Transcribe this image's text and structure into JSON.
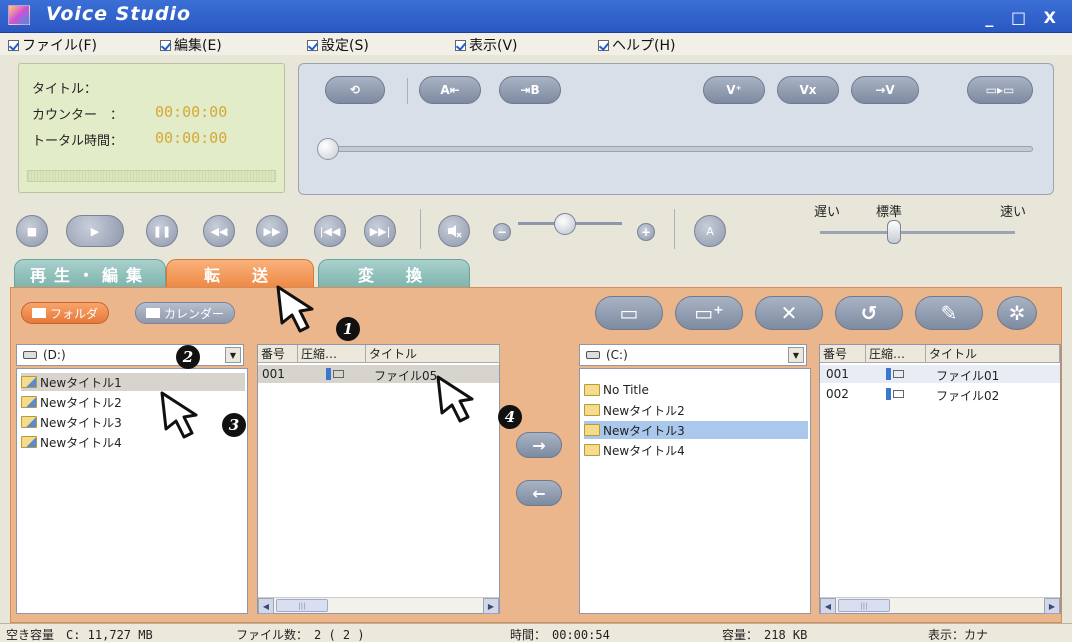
{
  "window": {
    "title": "Voice Studio",
    "controls": "_ □ X"
  },
  "menu": [
    {
      "label": "ファイル(F)"
    },
    {
      "label": "編集(E)"
    },
    {
      "label": "設定(S)"
    },
    {
      "label": "表示(V)"
    },
    {
      "label": "ヘルプ(H)"
    }
  ],
  "info": {
    "title_label": "タイトル：",
    "counter_label": "カウンター　：",
    "counter_value": "00:00:00",
    "total_label": "トータル時間：",
    "total_value": "00:00:00"
  },
  "edit_buttons": {
    "repeat": "⟲",
    "a_mark": "A⇤",
    "b_mark": "⇥B",
    "divide": "V⁺",
    "delete_mark": "Vx",
    "move_mark": "→V",
    "combine": "▭▸▭"
  },
  "transport": {
    "stop": "■",
    "play": "▶",
    "pause": "❚❚",
    "rewind": "◀◀",
    "forward": "▶▶",
    "prev": "|◀◀",
    "next": "▶▶|",
    "vol_minus": "−",
    "vol_plus": "+",
    "filter": "A",
    "volume_level_fraction": 0.45
  },
  "speed": {
    "slow": "遅い",
    "normal": "標準",
    "fast": "速い",
    "level_fraction": 0.38
  },
  "tabs": [
    {
      "label": "再生・編集"
    },
    {
      "label": "転　送"
    },
    {
      "label": "変　換"
    }
  ],
  "view_toggle": {
    "folder": "フォルダ",
    "calendar": "カレンダー"
  },
  "toolbar": {
    "new_folder": "▭",
    "add": "▭⁺",
    "delete": "✕",
    "undo": "↺",
    "edit": "✎",
    "extra": "✲"
  },
  "left_drive": {
    "label": "(D:)",
    "folders": [
      "Newタイトル1",
      "Newタイトル2",
      "Newタイトル3",
      "Newタイトル4"
    ]
  },
  "left_files": {
    "columns": [
      "番号",
      "圧縮…",
      "タイトル"
    ],
    "rows": [
      {
        "num": "001",
        "name": "ファイル05"
      }
    ]
  },
  "right_drive": {
    "label": "(C:)",
    "folders": [
      "No Title",
      "Newタイトル2",
      "Newタイトル3",
      "Newタイトル4"
    ]
  },
  "right_files": {
    "columns": [
      "番号",
      "圧縮…",
      "タイトル"
    ],
    "rows": [
      {
        "num": "001",
        "name": "ファイル01"
      },
      {
        "num": "002",
        "name": "ファイル02"
      }
    ]
  },
  "transfer_arrows": {
    "to_right": "→",
    "to_left": "←"
  },
  "markers": [
    "1",
    "2",
    "3",
    "4"
  ],
  "status": {
    "free": "空き容量　C: 11,727 MB",
    "files": "ファイル数：　2 ( 2 )",
    "time": "時間：　00:00:54",
    "size": "容量：　218 KB",
    "display": "表示：カナ"
  },
  "colors": {
    "title_bar": "#2a58c2",
    "active_tab": "#ee8a46",
    "inactive_tab": "#7fb4ae",
    "panel": "#ebb68c"
  }
}
